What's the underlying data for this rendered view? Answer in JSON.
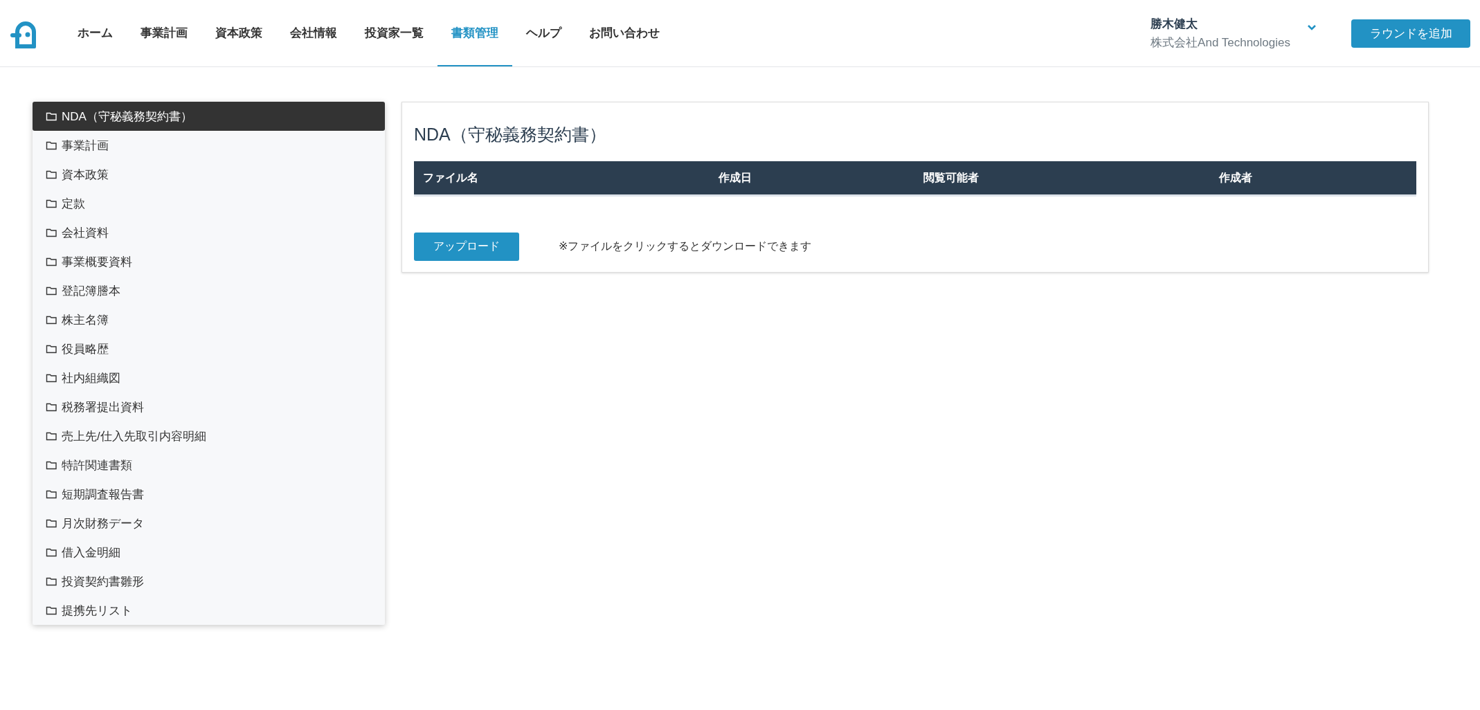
{
  "header": {
    "nav": [
      {
        "label": "ホーム",
        "selected": false
      },
      {
        "label": "事業計画",
        "selected": false
      },
      {
        "label": "資本政策",
        "selected": false
      },
      {
        "label": "会社情報",
        "selected": false
      },
      {
        "label": "投資家一覧",
        "selected": false
      },
      {
        "label": "書類管理",
        "selected": true
      },
      {
        "label": "ヘルプ",
        "selected": false
      },
      {
        "label": "お問い合わせ",
        "selected": false
      }
    ],
    "user": {
      "name": "勝木健太",
      "company": "株式会社And Technologies"
    },
    "add_round_button": "ラウンドを追加"
  },
  "sidebar": {
    "items": [
      {
        "label": "NDA（守秘義務契約書）",
        "selected": true
      },
      {
        "label": "事業計画",
        "selected": false
      },
      {
        "label": "資本政策",
        "selected": false
      },
      {
        "label": "定款",
        "selected": false
      },
      {
        "label": "会社資料",
        "selected": false
      },
      {
        "label": "事業概要資料",
        "selected": false
      },
      {
        "label": "登記簿謄本",
        "selected": false
      },
      {
        "label": "株主名簿",
        "selected": false
      },
      {
        "label": "役員略歴",
        "selected": false
      },
      {
        "label": "社内組織図",
        "selected": false
      },
      {
        "label": "税務署提出資料",
        "selected": false
      },
      {
        "label": "売上先/仕入先取引内容明細",
        "selected": false
      },
      {
        "label": "特許関連書類",
        "selected": false
      },
      {
        "label": "短期調査報告書",
        "selected": false
      },
      {
        "label": "月次財務データ",
        "selected": false
      },
      {
        "label": "借入金明細",
        "selected": false
      },
      {
        "label": "投資契約書雛形",
        "selected": false
      },
      {
        "label": "提携先リスト",
        "selected": false
      }
    ]
  },
  "panel": {
    "title": "NDA（守秘義務契約書）",
    "table": {
      "columns": [
        "ファイル名",
        "作成日",
        "閲覧可能者",
        "作成者"
      ]
    },
    "upload_button": "アップロード",
    "note": "※ファイルをクリックするとダウンロードできます"
  }
}
